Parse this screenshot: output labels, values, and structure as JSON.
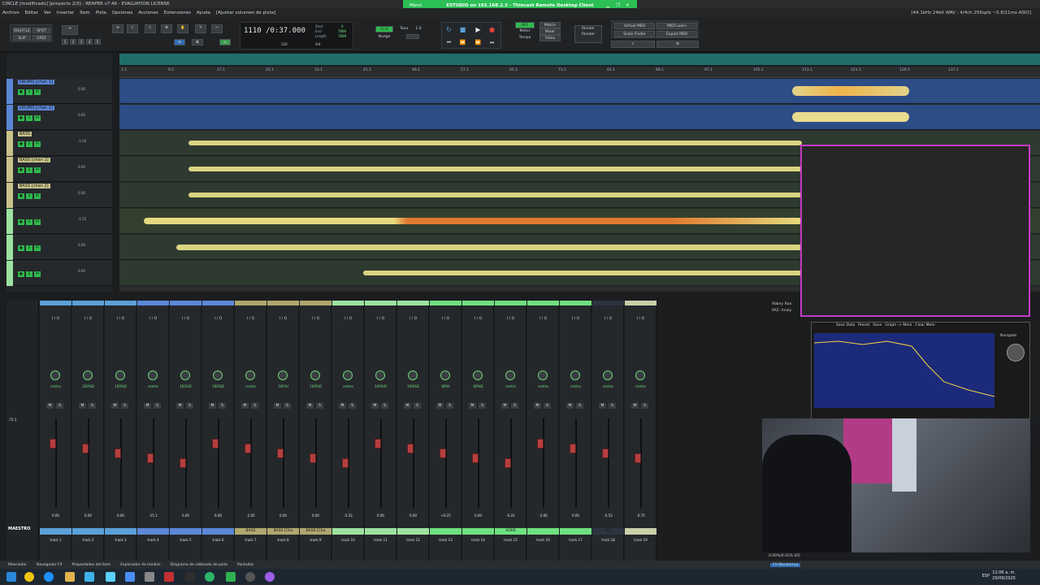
{
  "window": {
    "title": "CIRCLE [modificado] [proyecto 2/3] - REAPER v7.46 - EVALUATION LICENSE",
    "status_right": "[44.1kHz 24bit WAV : 4/4ch 256spls ~5.8/11ms ASIO]"
  },
  "menubar": {
    "items": [
      "Archivo",
      "Editar",
      "Ver",
      "Insertar",
      "Ítem",
      "Pista",
      "Opciones",
      "Acciones",
      "Extensiones",
      "Ayuda",
      "[Ajustar volumen de pista]"
    ]
  },
  "remote_desktop": {
    "menu": "Menú",
    "title": "ESTUDIO on 192.168.2.3 - Thincast Remote Desktop Client"
  },
  "toolbar": {
    "shuffle": "SHUFFLE",
    "spot": "SPOT",
    "slip": "SLIP",
    "grid": "GRID",
    "counters": [
      "1",
      "2",
      "3",
      "4",
      "5"
    ],
    "time_main": "1110 /0:37.000",
    "start_label": "Start",
    "end_label": "End",
    "length_label": "Length",
    "start_val": "0",
    "end_val": "7889",
    "length_val": "7889",
    "tempo": "120",
    "timesig": "4/4",
    "grid_label": "Grid",
    "taxa_label": "Taxa",
    "taxa_val": "1.0",
    "nudge_label": "Nudge",
    "off_label": "OFF",
    "meter_label": "Meter",
    "tempo_label": "Tempo",
    "matrix_label": "Matrix",
    "mixer_label": "Mixer",
    "video_label": "Video",
    "render_label": "Render",
    "render_sub": "Render",
    "virtual_midi": "Virtual MIDI",
    "scale_finder": "Scale Finder",
    "midi_learn": "MIDI Learn",
    "export_midi": "Export MIDI"
  },
  "ruler": {
    "marks": [
      "1.1",
      "9.1",
      "17.1",
      "25.1",
      "33.1",
      "41.1",
      "49.1",
      "57.1",
      "65.1",
      "73.1",
      "81.1",
      "89.1",
      "97.1",
      "105.1",
      "113.1",
      "121.1",
      "129.1",
      "137.1"
    ]
  },
  "tracks": [
    {
      "name": "DRUMS [chan 1]",
      "color": "#5b87d8",
      "vol": "0.00"
    },
    {
      "name": "DRUMS [chan 2]",
      "color": "#5b87d8",
      "vol": "0.00"
    },
    {
      "name": "BASS",
      "color": "#c9c38a",
      "vol": "-1.03"
    },
    {
      "name": "BASS [chan 1]",
      "color": "#c9c38a",
      "vol": "0.00"
    },
    {
      "name": "BASS [chan 2]",
      "color": "#c9c38a",
      "vol": "0.00"
    },
    {
      "name": "",
      "color": "#9de3a0",
      "vol": "-1.51"
    },
    {
      "name": "",
      "color": "#9de3a0",
      "vol": "0.00"
    },
    {
      "name": "",
      "color": "#9de3a0",
      "vol": "0.00"
    }
  ],
  "mixer": {
    "master_label": "MAESTRO",
    "master_db": "-72.3",
    "io_label": "I / O",
    "strips": [
      {
        "num": "track 1",
        "label": "",
        "db": "0.00",
        "pan": "centro",
        "color": "#5aa0d8"
      },
      {
        "num": "track 2",
        "label": "",
        "db": "0.00",
        "pan": "100%D",
        "color": "#5aa0d8"
      },
      {
        "num": "track 3",
        "label": "",
        "db": "0.00",
        "pan": "100%D",
        "color": "#5aa0d8"
      },
      {
        "num": "track 4",
        "label": "",
        "db": "-15.1",
        "pan": "centro",
        "color": "#5b87d8"
      },
      {
        "num": "track 5",
        "label": "",
        "db": "0.00",
        "pan": "100%D",
        "color": "#5b87d8"
      },
      {
        "num": "track 6",
        "label": "",
        "db": "0.00",
        "pan": "100%D",
        "color": "#5b87d8"
      },
      {
        "num": "track 7",
        "label": "BASS",
        "db": "-2.05",
        "pan": "centro",
        "color": "#b0a66e"
      },
      {
        "num": "track 8",
        "label": "BASS [Cha",
        "db": "0.00",
        "pan": "100%I",
        "color": "#b0a66e"
      },
      {
        "num": "track 9",
        "label": "BASS [Cha",
        "db": "0.00",
        "pan": "100%D",
        "color": "#b0a66e"
      },
      {
        "num": "track 10",
        "label": "",
        "db": "-5.53",
        "pan": "centro",
        "color": "#9de3a0"
      },
      {
        "num": "track 11",
        "label": "",
        "db": "0.00",
        "pan": "100%D",
        "color": "#9de3a0"
      },
      {
        "num": "track 12",
        "label": "",
        "db": "0.00",
        "pan": "100%D",
        "color": "#9de3a0"
      },
      {
        "num": "track 13",
        "label": "",
        "db": "+0.25",
        "pan": "60%I",
        "color": "#6fe07f"
      },
      {
        "num": "track 14",
        "label": "",
        "db": "0.00",
        "pan": "60%D",
        "color": "#6fe07f"
      },
      {
        "num": "track 15",
        "label": "VOXR",
        "db": "-0.22",
        "pan": "centro",
        "color": "#6fe07f"
      },
      {
        "num": "track 16",
        "label": "",
        "db": "-2.66",
        "pan": "centro",
        "color": "#6fe07f"
      },
      {
        "num": "track 17",
        "label": "",
        "db": "0.00",
        "pan": "centro",
        "color": "#6fe07f"
      },
      {
        "num": "track 18",
        "label": "fx1",
        "db": "-5.53",
        "pan": "centro",
        "color": "#2c3440"
      },
      {
        "num": "track 19",
        "label": "",
        "db": "-0.75",
        "pan": "centro",
        "color": "#c9d0a8"
      }
    ]
  },
  "plugin": {
    "tabs": [
      "Save Data",
      "Preset",
      "Save",
      "Graph -> Mem",
      "Clear Mem"
    ],
    "fx_list": [
      "Abbey Roa",
      "PAZ- Analy"
    ],
    "label": "Navigate"
  },
  "bottom_tabs": [
    "Mezclador",
    "Navegador FX",
    "Propiedades del ítem",
    "Explorador de medios",
    "Diagrama de cableado de pista",
    "Pantallas"
  ],
  "cpu_label": "0.00%/0.02% 0/0",
  "fx_monitoring": "FX Monitoring",
  "taskbar": {
    "lang": "ESP",
    "time": "12:06 a. m.",
    "date": "20/09/2025"
  }
}
